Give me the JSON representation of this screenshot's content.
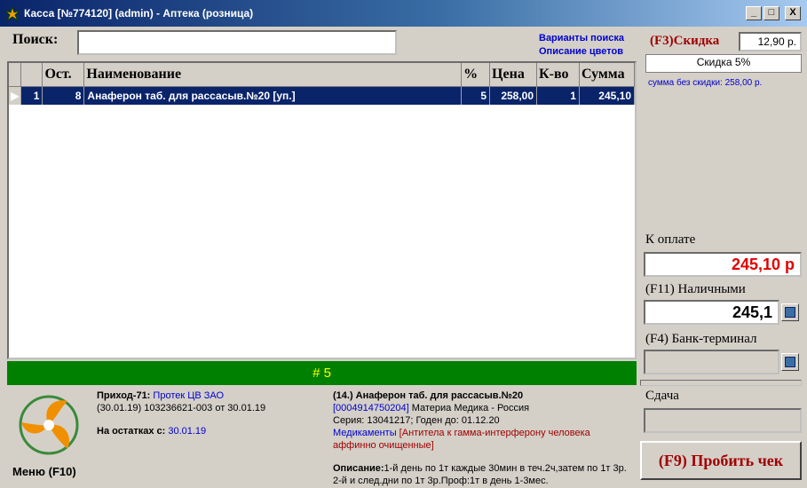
{
  "window": {
    "title": "Касса [№774120] (admin) - Аптека (розница)",
    "min_label": "_",
    "max_label": "□",
    "close_label": "X"
  },
  "search": {
    "label": "Поиск:",
    "value": "",
    "link_variants": "Варианты поиска",
    "link_colors": "Описание цветов"
  },
  "grid": {
    "columns": [
      "",
      "",
      "Ост.",
      "Наименование",
      "%",
      "Цена",
      "К-во",
      "Сумма"
    ],
    "rows": [
      {
        "indicator": "▶",
        "n": "1",
        "stock": "8",
        "name": "Анаферон таб. для рассасыв.№20 [уп.]",
        "pct": "5",
        "price": "258,00",
        "qty": "1",
        "sum": "245,10"
      }
    ]
  },
  "status": {
    "text": "# 5"
  },
  "discount": {
    "label": "(F3)Скидка",
    "value": "12,90 р.",
    "name": "Скидка 5%",
    "note": "сумма без скидки: 258,00 р."
  },
  "payment": {
    "total_label": "К оплате",
    "total_value": "245,10 р",
    "cash_label": "(F11) Наличными",
    "cash_value": "245,1",
    "bank_label": "(F4) Банк-терминал",
    "bank_value": "",
    "change_label": "Сдача",
    "change_value": "",
    "print_button": "(F9) Пробить чек"
  },
  "menu": {
    "label": "Меню (F10)"
  },
  "receipt": {
    "income_label": "Приход-71:",
    "supplier": "Протек ЦВ ЗАО",
    "doc": "(30.01.19) 103236621-003 от 30.01.19",
    "balance_label": "На остатках с:",
    "balance_date": "30.01.19"
  },
  "product": {
    "title": "(14.) Анаферон таб. для рассасыв.№20",
    "barcode": "[0004914750204]",
    "maker": "Материа Медика - Россия",
    "series": "Серия: 13041217; Годен до: 01.12.20",
    "category": "Медикаменты",
    "substance": "[Антитела к гамма-интерферону человека аффинно очищенные]",
    "desc_label": "Описание:",
    "desc_text": "1-й день по 1т каждые 30мин в теч.2ч,затем по 1т 3р. 2-й и след.дни по 1т 3р.Проф:1т в день 1-3мес."
  },
  "colors": {
    "accent_green": "#008000",
    "total_red": "#e00000",
    "selected_row": "#0a246a"
  },
  "icons": [
    "app-logo-icon",
    "calculator-icon",
    "menu-logo-icon"
  ]
}
